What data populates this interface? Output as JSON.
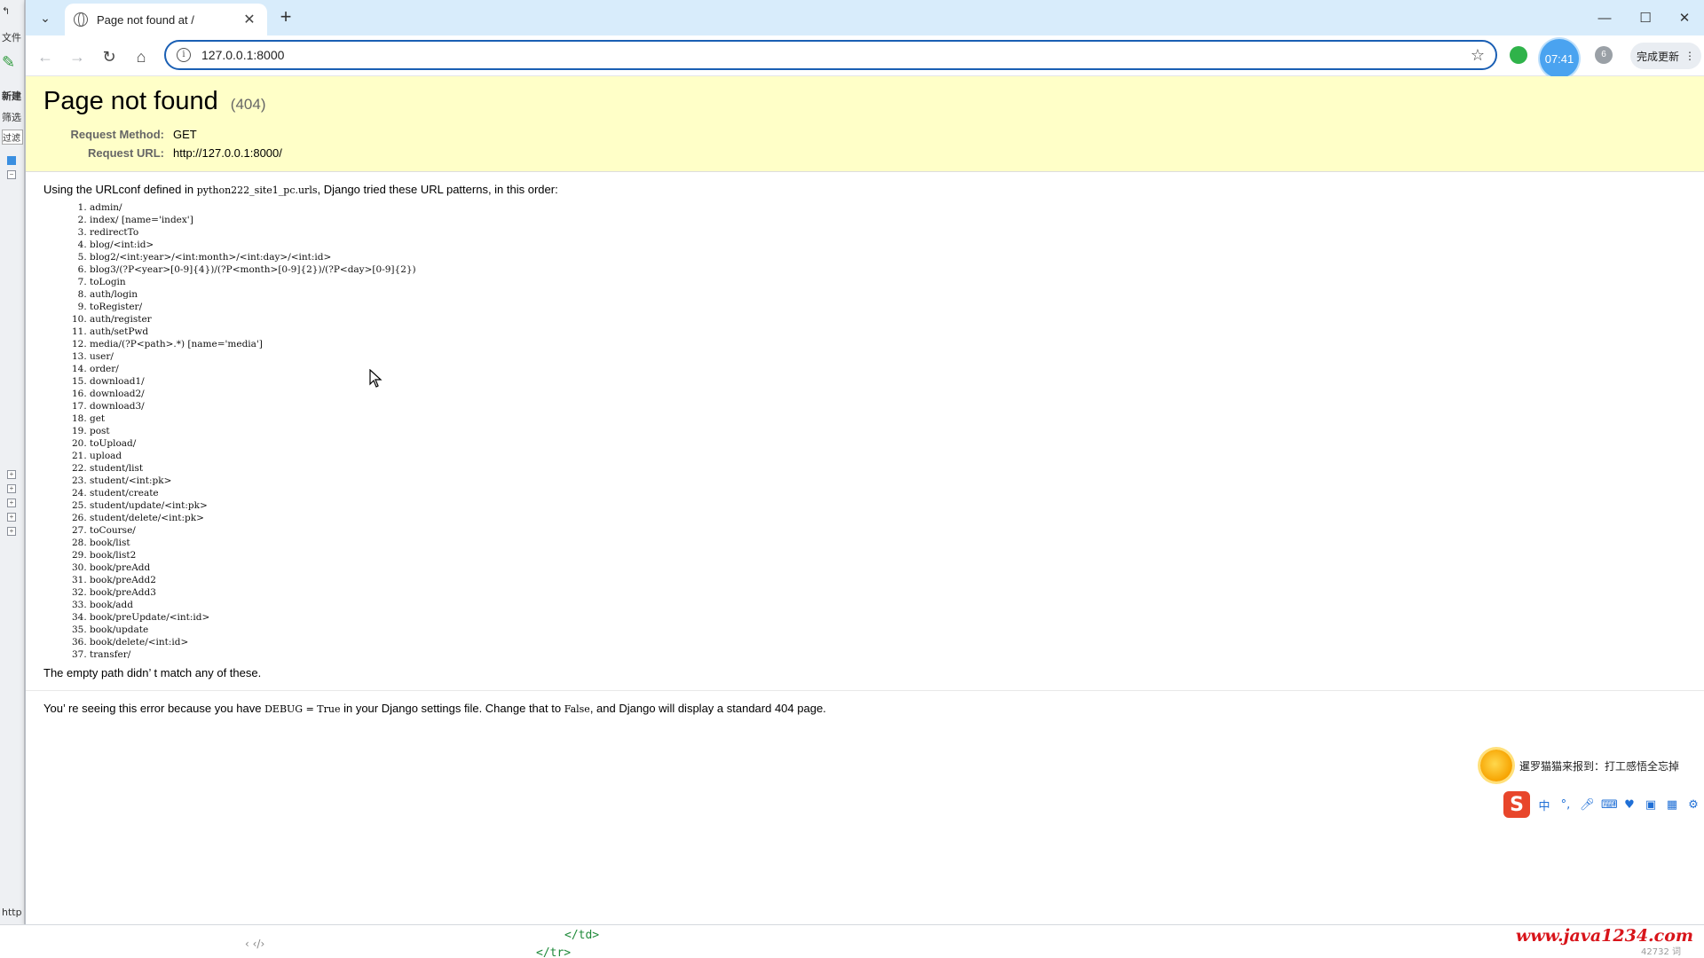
{
  "browser": {
    "tab_title": "Page not found at /",
    "url": "127.0.0.1:8000",
    "clock": "07:41",
    "update_label": "完成更新",
    "ext_badge": "6"
  },
  "error": {
    "title": "Page not found",
    "code": "(404)",
    "meta": [
      {
        "key": "Request Method:",
        "value": "GET"
      },
      {
        "key": "Request URL:",
        "value": "http://127.0.0.1:8000/"
      }
    ],
    "lead_before": "Using the URLconf defined in ",
    "urlconf": "python222_site1_pc.urls",
    "lead_after": ", Django tried these URL patterns, in this order:",
    "patterns": [
      "admin/",
      "index/ [name='index']",
      "redirectTo",
      "blog/<int:id>",
      "blog2/<int:year>/<int:month>/<int:day>/<int:id>",
      "blog3/(?P<year>[0-9]{4})/(?P<month>[0-9]{2})/(?P<day>[0-9]{2})",
      "toLogin",
      "auth/login",
      "toRegister/",
      "auth/register",
      "auth/setPwd",
      "media/(?P<path>.*) [name='media']",
      "user/",
      "order/",
      "download1/",
      "download2/",
      "download3/",
      "get",
      "post",
      "toUpload/",
      "upload",
      "student/list",
      "student/<int:pk>",
      "student/create",
      "student/update/<int:pk>",
      "student/delete/<int:pk>",
      "toCourse/",
      "book/list",
      "book/list2",
      "book/preAdd",
      "book/preAdd2",
      "book/preAdd3",
      "book/add",
      "book/preUpdate/<int:id>",
      "book/update",
      "book/delete/<int:id>",
      "transfer/"
    ],
    "empty_path": "The empty path didn’ t match any of these.",
    "explain_1": "You’ re seeing this error because you have ",
    "debug_code": "DEBUG = True",
    "explain_2": " in your Django settings file. Change that to ",
    "false_code": "False",
    "explain_3": ", and Django will display a standard 404 page."
  },
  "ime": {
    "message": "暹罗猫猫来报到：打工感悟全忘掉",
    "mode": "中"
  },
  "left_strip": {
    "item1": "文件",
    "item2": "新建",
    "item3": "筛选",
    "item4": "过滤",
    "bottom": "http"
  },
  "editor": {
    "line1": "</td>",
    "line2": "</tr>",
    "nav": "‹  ‹/›",
    "wordcount": "42732 词"
  },
  "watermark": "www.java1234.com",
  "colors": {
    "summary_bg": "#ffffc8",
    "tabbar_bg": "#d8ecfb",
    "omnibox_border": "#1a5fb4",
    "watermark": "#d8141a"
  }
}
